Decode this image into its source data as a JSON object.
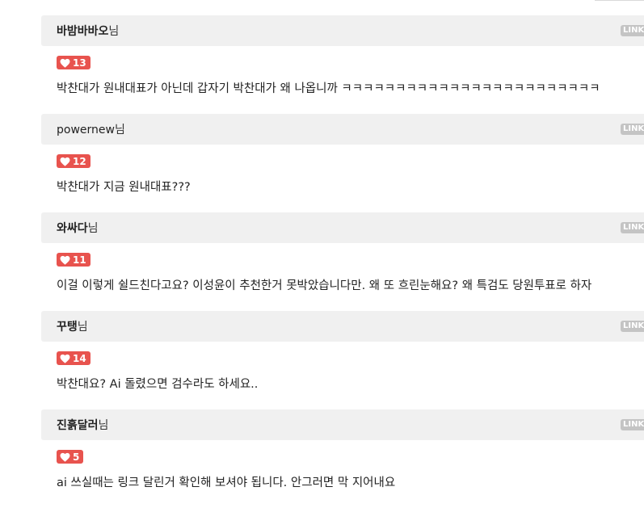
{
  "link_label": "LINK",
  "author_suffix": "님",
  "like_color": "#e8534e",
  "comments": [
    {
      "author": "바밤바바오",
      "likes": "13",
      "text": "박찬대가 원내대표가 아닌데 갑자기 박찬대가 왜 나옵니까 ㅋㅋㅋㅋㅋㅋㅋㅋㅋㅋㅋㅋㅋㅋㅋㅋㅋㅋㅋㅋㅋㅋㅋㅋ"
    },
    {
      "author": "powernew",
      "likes": "12",
      "text": "박찬대가 지금 원내대표???"
    },
    {
      "author": "와싸다",
      "likes": "11",
      "text": "이걸 이렇게 쉴드친다고요? 이성윤이 추천한거 못박았습니다만. 왜 또 흐린눈해요? 왜 특검도 당원투표로 하자"
    },
    {
      "author": "꾸탱",
      "likes": "14",
      "text": "박찬대요? Ai 돌렸으면 검수라도 하세요.."
    },
    {
      "author": "진흙달러",
      "likes": "5",
      "text": "ai 쓰실때는 링크 달린거 확인해 보셔야 됩니다. 안그러면 막 지어내요"
    }
  ]
}
